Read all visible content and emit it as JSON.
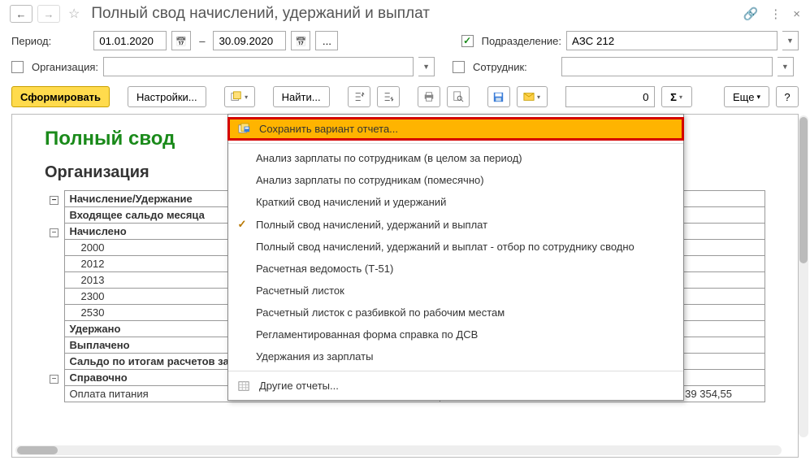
{
  "title": "Полный свод начислений, удержаний и выплат",
  "period": {
    "label": "Период:",
    "from": "01.01.2020",
    "to": "30.09.2020"
  },
  "subdivision": {
    "label": "Подразделение:",
    "value": "АЗС 212",
    "checked": true
  },
  "organization": {
    "label": "Организация:",
    "value": "",
    "checked": false
  },
  "employee": {
    "label": "Сотрудник:",
    "value": "",
    "checked": false
  },
  "toolbar": {
    "form": "Сформировать",
    "settings": "Настройки...",
    "find": "Найти...",
    "more": "Еще",
    "help": "?",
    "num": "0"
  },
  "report": {
    "title": "Полный свод",
    "org_title": "Организация",
    "header": "Начисление/Удержание",
    "rows": [
      {
        "label": "Входящее сальдо месяца",
        "bold": true
      },
      {
        "label": "Начислено",
        "bold": true
      },
      {
        "label": "2000",
        "indent": true
      },
      {
        "label": "2012",
        "indent": true
      },
      {
        "label": "2013",
        "indent": true
      },
      {
        "label": "2300",
        "indent": true
      },
      {
        "label": "2530",
        "indent": true
      },
      {
        "label": "Удержано",
        "bold": true
      },
      {
        "label": "Выплачено",
        "bold": true
      },
      {
        "label": "Сальдо по итогам расчетов за",
        "bold": true
      },
      {
        "label": "Справочно",
        "bold": true
      },
      {
        "label": "Оплата питания"
      }
    ],
    "value_example": "39 354,55"
  },
  "menu": {
    "save": "Сохранить вариант отчета...",
    "items": [
      "Анализ зарплаты по сотрудникам (в целом за период)",
      "Анализ зарплаты по сотрудникам (помесячно)",
      "Краткий свод начислений и удержаний",
      "Полный свод начислений, удержаний и выплат",
      "Полный свод начислений, удержаний и выплат - отбор по сотруднику сводно",
      "Расчетная ведомость (Т-51)",
      "Расчетный листок",
      "Расчетный листок с разбивкой по рабочим местам",
      "Регламентированная форма справка по ДСВ",
      "Удержания из зарплаты"
    ],
    "other": "Другие отчеты...",
    "selected_index": 3
  }
}
